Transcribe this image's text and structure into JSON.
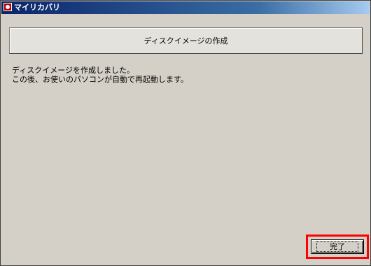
{
  "window": {
    "title": "マイリカバリ"
  },
  "heading": {
    "text": "ディスクイメージの作成"
  },
  "message": {
    "lines": [
      "ディスクイメージを作成しました。",
      "この後、お使いのパソコンが自動で再起動します。"
    ]
  },
  "actions": {
    "finish_label": "完了"
  },
  "colors": {
    "highlight": "#ff0000",
    "title_bar": "#0a246a",
    "window_bg": "#d4d0c8"
  },
  "icons": {
    "app_icon": "my-recovery-icon"
  }
}
